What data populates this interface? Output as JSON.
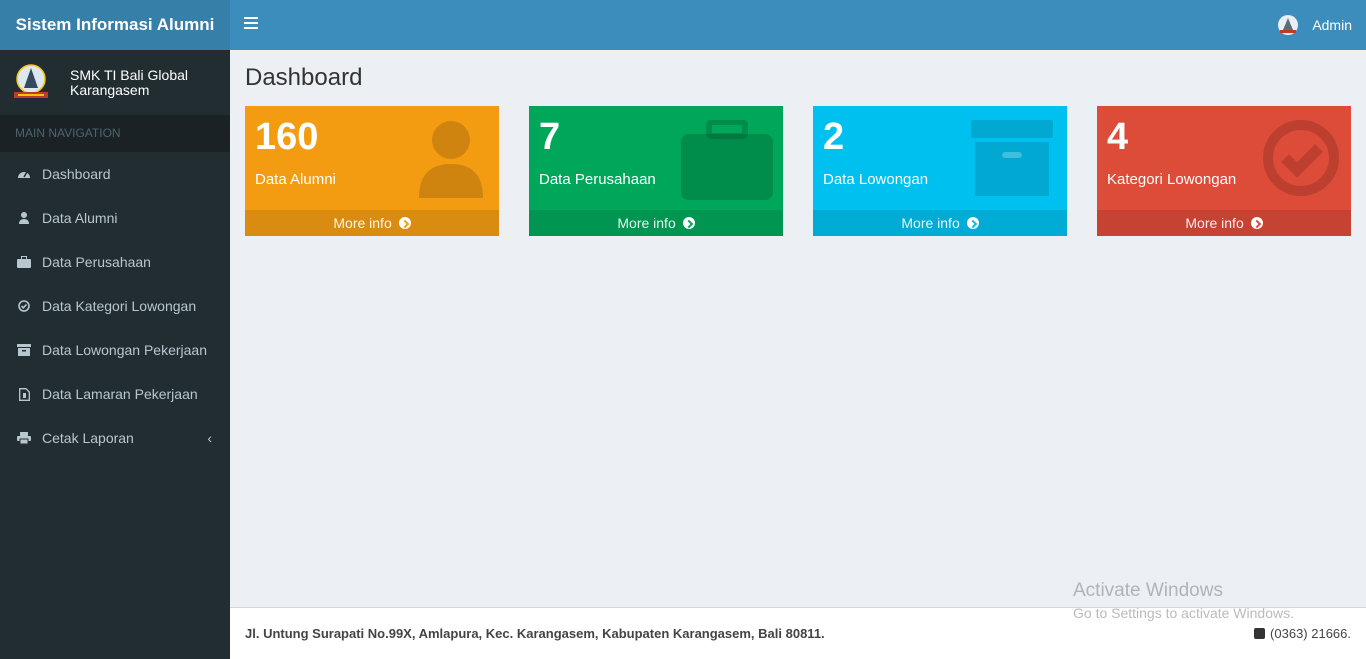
{
  "app": {
    "title": "Sistem Informasi Alumni",
    "user_name": "Admin"
  },
  "sidebar": {
    "school_name": "SMK TI Bali Global Karangasem",
    "nav_header": "MAIN NAVIGATION",
    "items": [
      {
        "label": "Dashboard",
        "icon": "dashboard-icon"
      },
      {
        "label": "Data Alumni",
        "icon": "user-icon"
      },
      {
        "label": "Data Perusahaan",
        "icon": "briefcase-icon"
      },
      {
        "label": "Data Kategori Lowongan",
        "icon": "check-circle-icon"
      },
      {
        "label": "Data Lowongan Pekerjaan",
        "icon": "archive-icon"
      },
      {
        "label": "Data Lamaran Pekerjaan",
        "icon": "file-icon"
      },
      {
        "label": "Cetak Laporan",
        "icon": "print-icon"
      }
    ]
  },
  "main": {
    "page_title": "Dashboard",
    "boxes": [
      {
        "count": "160",
        "label": "Data Alumni",
        "more": "More info",
        "color": "#f39c12",
        "icon": "user-icon"
      },
      {
        "count": "7",
        "label": "Data Perusahaan",
        "more": "More info",
        "color": "#00a65a",
        "icon": "briefcase-icon"
      },
      {
        "count": "2",
        "label": "Data Lowongan",
        "more": "More info",
        "color": "#00c0ef",
        "icon": "archive-icon"
      },
      {
        "count": "4",
        "label": "Kategori Lowongan",
        "more": "More info",
        "color": "#dd4b39",
        "icon": "check-circle-icon"
      }
    ]
  },
  "footer": {
    "address": "Jl. Untung Surapati No.99X, Amlapura, Kec. Karangasem, Kabupaten Karangasem, Bali 80811.",
    "phone": "(0363) 21666."
  },
  "watermark": {
    "line1": "Activate Windows",
    "line2": "Go to Settings to activate Windows."
  }
}
